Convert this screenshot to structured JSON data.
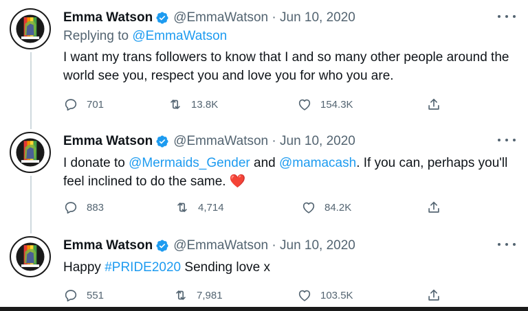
{
  "author": {
    "name": "Emma Watson",
    "handle": "@EmmaWatson",
    "date_sep": "·",
    "date": "Jun 10, 2020"
  },
  "colors": {
    "link": "#1d9bf0",
    "secondary": "#536471",
    "verified": "#1d9bf0",
    "heart": "#e0102a"
  },
  "tweets": [
    {
      "replying_label": "Replying to",
      "replying_handle": "@EmmaWatson",
      "text": "I want my trans followers to know that I and so many other people around the world see you, respect you and love you for who you are.",
      "replies": "701",
      "retweets": "13.8K",
      "likes": "154.3K"
    },
    {
      "text_before": "I donate to",
      "mention1": "@Mermaids_Gender",
      "text_and": "and",
      "mention2": "@mamacash",
      "text_after": ". If you can, perhaps you'll feel inclined to do the same.",
      "emoji": "❤️",
      "replies": "883",
      "retweets": "4,714",
      "likes": "84.2K"
    },
    {
      "text_before": "Happy",
      "hashtag": "#PRIDE2020",
      "text_after": "Sending love x",
      "replies": "551",
      "retweets": "7,981",
      "likes": "103.5K"
    }
  ],
  "icons": {
    "reply": "reply-icon",
    "retweet": "retweet-icon",
    "like": "heart-icon",
    "share": "share-icon",
    "verified": "verified-badge-icon",
    "more": "more-options-icon"
  }
}
